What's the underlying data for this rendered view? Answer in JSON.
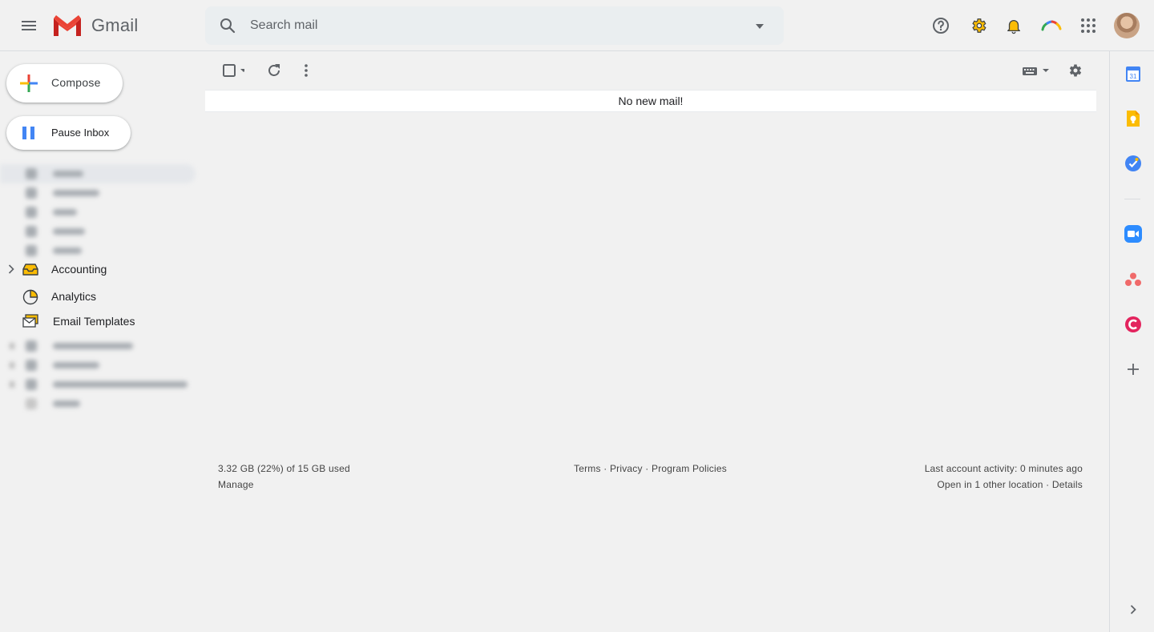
{
  "app": {
    "name": "Gmail"
  },
  "search": {
    "placeholder": "Search mail"
  },
  "sidebar": {
    "compose_label": "Compose",
    "pause_label": "Pause Inbox",
    "labels": [
      {
        "name": "Accounting"
      },
      {
        "name": "Analytics"
      },
      {
        "name": "Email Templates"
      }
    ]
  },
  "main": {
    "empty_message": "No new mail!"
  },
  "footer": {
    "storage": "3.32 GB (22%) of 15 GB used",
    "manage": "Manage",
    "terms": "Terms",
    "privacy": "Privacy",
    "program_policies": "Program Policies",
    "separator": "·",
    "last_activity": "Last account activity: 0 minutes ago",
    "other_location": "Open in 1 other location",
    "details": "Details"
  },
  "rail": {
    "calendar_day": "31"
  },
  "colors": {
    "google_blue": "#4285f4",
    "google_red": "#ea4335",
    "google_yellow": "#fbbc04",
    "google_green": "#34a853",
    "zoom_blue": "#2d8cff",
    "asana_coral": "#f06a6a",
    "clockify_pink": "#e3245e"
  }
}
